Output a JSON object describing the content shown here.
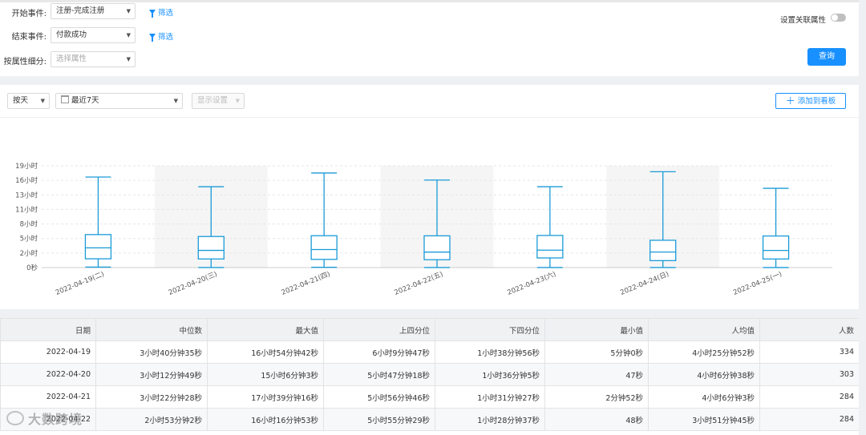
{
  "filters": {
    "start_event_label": "开始事件:",
    "start_event_value": "注册-完成注册",
    "end_event_label": "结束事件:",
    "end_event_value": "付款成功",
    "breakdown_label": "按属性细分:",
    "breakdown_placeholder": "选择属性",
    "filter_link_label": "筛选",
    "relation_toggle_label": "设置关联属性",
    "relation_toggle_on": false,
    "query_button": "查询"
  },
  "chart_toolbar": {
    "granularity": "按天",
    "date_range": "最近7天",
    "display_settings": "显示设置",
    "add_to_board": "添加到看板"
  },
  "chart_data": {
    "type": "boxplot",
    "categories": [
      "2022-04-19(二)",
      "2022-04-20(三)",
      "2022-04-21(四)",
      "2022-04-22(五)",
      "2022-04-23(六)",
      "2022-04-24(日)",
      "2022-04-25(一)"
    ],
    "y_tick_labels": [
      "0秒",
      "2小时",
      "5小时",
      "8小时",
      "11小时",
      "13小时",
      "16小时",
      "19小时"
    ],
    "y_unit": "hours",
    "ylim": [
      0,
      19
    ],
    "series": [
      {
        "min": 0.083,
        "q1": 1.64,
        "median": 3.68,
        "q3": 6.16,
        "max": 16.91
      },
      {
        "min": 0.013,
        "q1": 1.61,
        "median": 3.21,
        "q3": 5.8,
        "max": 15.1
      },
      {
        "min": 0.044,
        "q1": 1.53,
        "median": 3.37,
        "q3": 5.95,
        "max": 17.66
      },
      {
        "min": 0.013,
        "q1": 1.47,
        "median": 2.89,
        "q3": 5.93,
        "max": 16.35
      },
      {
        "min": 0.01,
        "q1": 1.8,
        "median": 3.25,
        "q3": 6.0,
        "max": 15.1
      },
      {
        "min": 0.01,
        "q1": 1.3,
        "median": 2.9,
        "q3": 5.1,
        "max": 17.9
      },
      {
        "min": 0.01,
        "q1": 1.6,
        "median": 3.2,
        "q3": 5.9,
        "max": 14.8
      }
    ],
    "grid": true
  },
  "table": {
    "headers": [
      "日期",
      "中位数",
      "最大值",
      "上四分位",
      "下四分位",
      "最小值",
      "人均值",
      "人数"
    ],
    "rows": [
      [
        "2022-04-19",
        "3小时40分钟35秒",
        "16小时54分钟42秒",
        "6小时9分钟47秒",
        "1小时38分钟56秒",
        "5分钟0秒",
        "4小时25分钟52秒",
        "334"
      ],
      [
        "2022-04-20",
        "3小时12分钟49秒",
        "15小时6分钟3秒",
        "5小时47分钟18秒",
        "1小时36分钟5秒",
        "47秒",
        "4小时6分钟38秒",
        "303"
      ],
      [
        "2022-04-21",
        "3小时22分钟28秒",
        "17小时39分钟16秒",
        "5小时56分钟46秒",
        "1小时31分钟27秒",
        "2分钟52秒",
        "4小时6分钟3秒",
        "284"
      ],
      [
        "2022-04-22",
        "2小时53分钟2秒",
        "16小时16分钟53秒",
        "5小时55分钟29秒",
        "1小时28分钟37秒",
        "48秒",
        "3小时51分钟45秒",
        "284"
      ]
    ]
  },
  "watermark": "大数跨境",
  "colors": {
    "accent": "#1890ff",
    "box_stroke": "#1a9bd7",
    "band": "#f5f5f5"
  }
}
